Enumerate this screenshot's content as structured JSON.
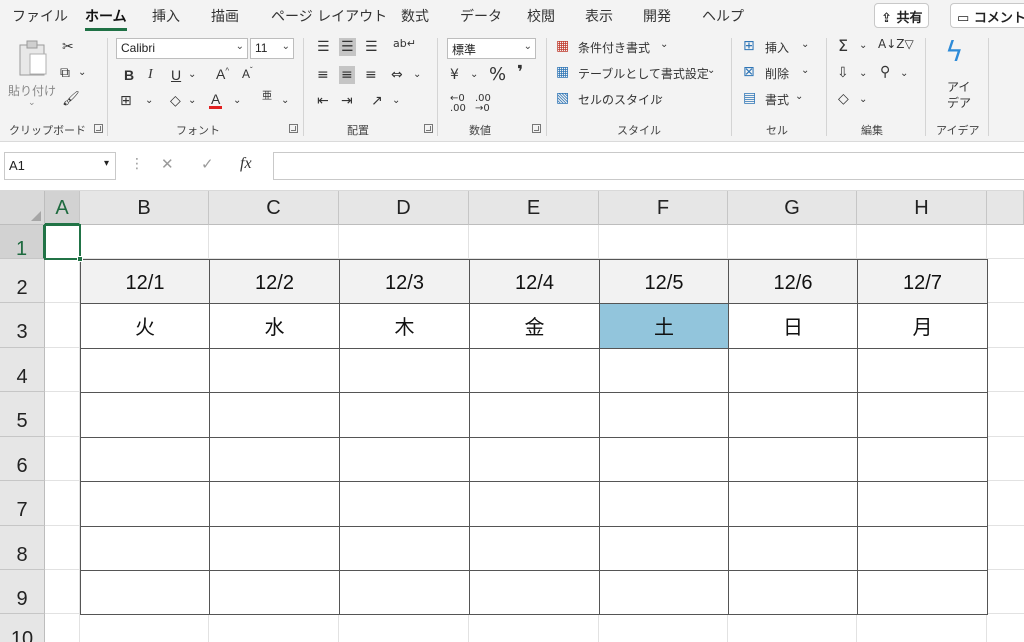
{
  "menu": {
    "tabs": [
      "ファイル",
      "ホーム",
      "挿入",
      "描画",
      "ページ レイアウト",
      "数式",
      "データ",
      "校閲",
      "表示",
      "開発",
      "ヘルプ"
    ],
    "share_label": "共有",
    "comment_label": "コメント"
  },
  "ribbon": {
    "clipboard": {
      "paste_label": "貼り付け",
      "group_label": "クリップボード"
    },
    "font": {
      "name": "Calibri",
      "size": "11",
      "group_label": "フォント",
      "furigana": "亜"
    },
    "alignment": {
      "group_label": "配置"
    },
    "number": {
      "format": "標準",
      "group_label": "数値"
    },
    "styles": {
      "conditional_label": "条件付き書式",
      "table_label": "テーブルとして書式設定",
      "cell_style_label": "セルのスタイル",
      "group_label": "スタイル"
    },
    "cells": {
      "insert_label": "挿入",
      "delete_label": "削除",
      "format_label": "書式",
      "group_label": "セル"
    },
    "editing": {
      "group_label": "編集"
    },
    "ideas": {
      "label_line1": "アイ",
      "label_line2": "デア",
      "group_label": "アイデア"
    }
  },
  "formula_bar": {
    "name_box": "A1",
    "content": ""
  },
  "sheet": {
    "columns": [
      "A",
      "B",
      "C",
      "D",
      "E",
      "F",
      "G",
      "H"
    ],
    "rows": [
      "1",
      "2",
      "3",
      "4",
      "5",
      "6",
      "7",
      "8",
      "9",
      "10"
    ],
    "dates": [
      "12/1",
      "12/2",
      "12/3",
      "12/4",
      "12/5",
      "12/6",
      "12/7"
    ],
    "weekdays": [
      "火",
      "水",
      "木",
      "金",
      "土",
      "日",
      "月"
    ],
    "selected_cell": "A1"
  },
  "colors": {
    "accent_green": "#217346",
    "header_fill": "#f2f2f2",
    "saturday_fill": "#92c5dc",
    "table_border": "#555555"
  }
}
